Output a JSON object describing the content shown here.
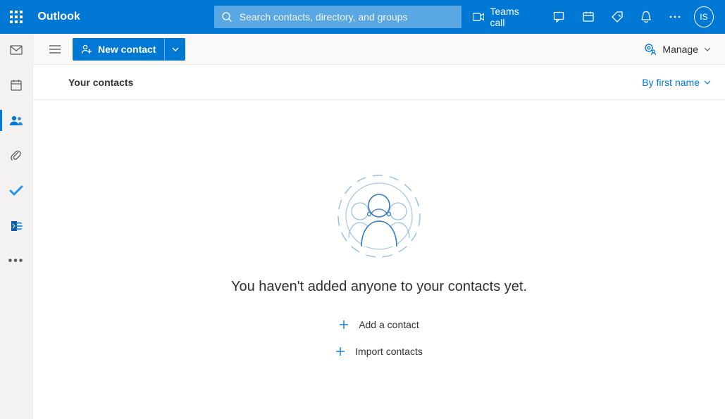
{
  "header": {
    "app_title": "Outlook",
    "search_placeholder": "Search contacts, directory, and groups",
    "teams_call_label": "Teams call",
    "avatar_initials": "IS"
  },
  "cmdbar": {
    "new_contact_label": "New contact",
    "manage_label": "Manage"
  },
  "subheader": {
    "title": "Your contacts",
    "sort_label": "By first name"
  },
  "empty_state": {
    "message": "You haven't added anyone to your contacts yet.",
    "add_label": "Add a contact",
    "import_label": "Import contacts"
  }
}
